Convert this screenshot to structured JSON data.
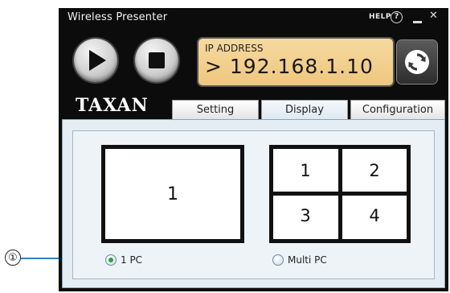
{
  "window": {
    "title": "Wireless Presenter",
    "help_label": "HELP",
    "help_icon_char": "?",
    "close_char": "✕"
  },
  "controls": {
    "play_icon": "play-icon",
    "stop_icon": "stop-icon",
    "refresh_icon": "refresh-icon"
  },
  "ip_display": {
    "label": "IP ADDRESS",
    "value": "> 192.168.1.10"
  },
  "logo": "TAXAN",
  "tabs": [
    {
      "label": "Setting"
    },
    {
      "label": "Display",
      "selected": true
    },
    {
      "label": "Configuration"
    }
  ],
  "display": {
    "single_layout_number": "1",
    "multi_layout_numbers": [
      "1",
      "2",
      "3",
      "4"
    ],
    "options": [
      {
        "label": "1 PC",
        "checked": true
      },
      {
        "label": "Multi PC",
        "checked": false
      }
    ]
  },
  "callout": {
    "marker": "①"
  },
  "colors": {
    "window_bg": "#0c0c0c",
    "ip_display_bg": "#f2cf8c",
    "panel_bg": "#e4edf4",
    "callout_line": "#3a7ec0",
    "radio_selected": "#2ea043"
  }
}
